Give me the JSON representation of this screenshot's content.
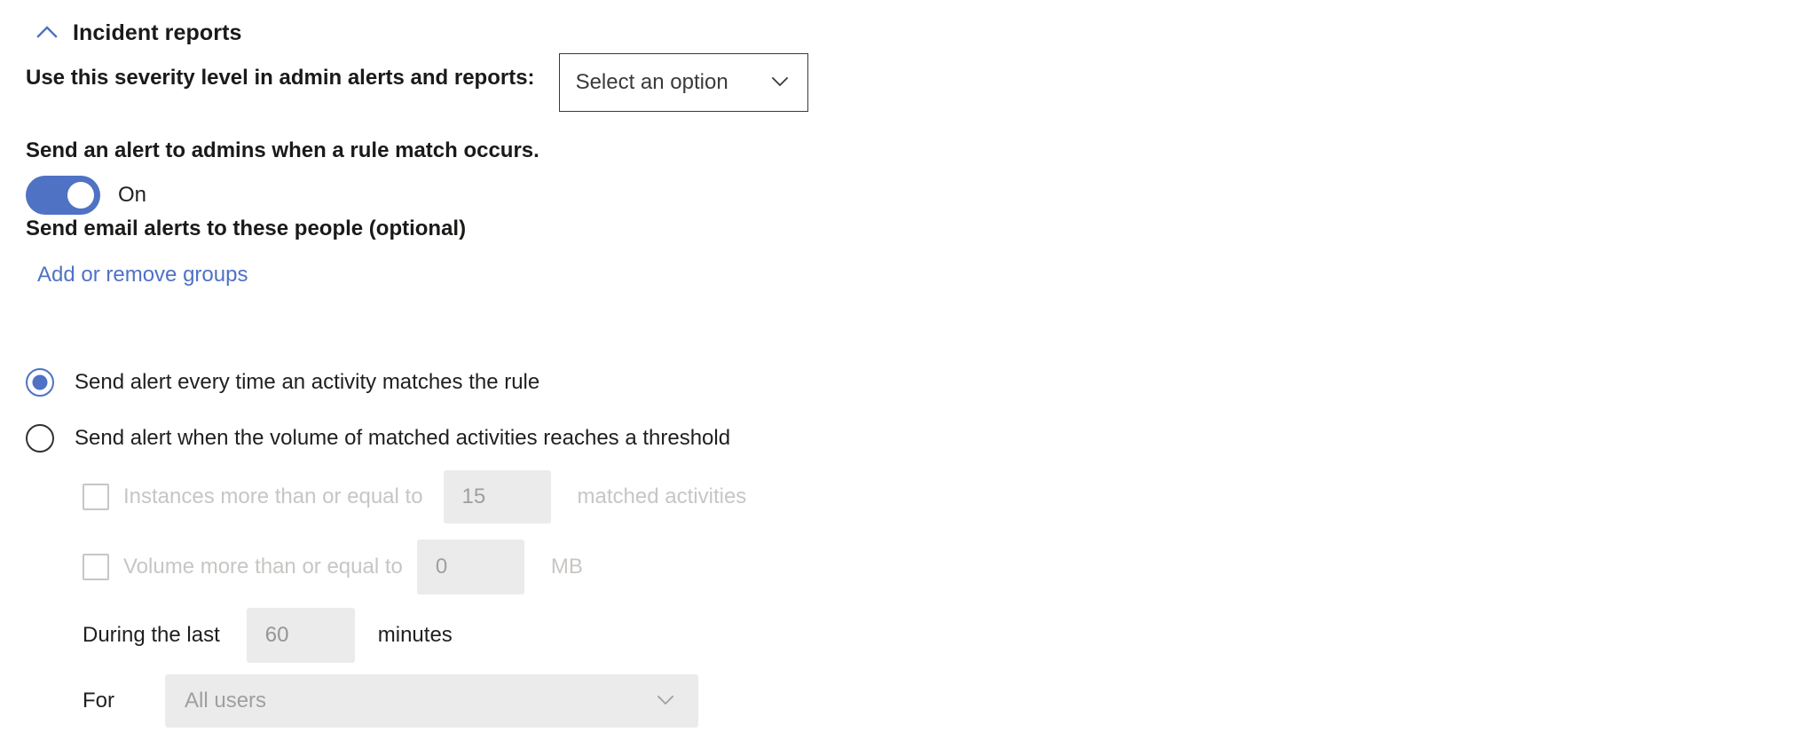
{
  "section": {
    "title": "Incident reports",
    "collapse_icon": "chevron-up-icon",
    "accent_color": "#4f72c4"
  },
  "severity": {
    "label": "Use this severity level in admin alerts and reports:",
    "dropdown_value": "Select an option",
    "dropdown_icon": "chevron-down-icon"
  },
  "admin_alert": {
    "description": "Send an alert to admins when a rule match occurs.",
    "toggle_state": "On",
    "toggle_on": true
  },
  "email_alerts": {
    "label": "Send email alerts to these people (optional)",
    "link": "Add or remove groups"
  },
  "alert_mode": {
    "options": [
      {
        "label": "Send alert every time an activity matches the rule",
        "selected": true
      },
      {
        "label": "Send alert when the volume of matched activities reaches a threshold",
        "selected": false
      }
    ]
  },
  "threshold": {
    "instances": {
      "checkbox_label": "Instances more than or equal to",
      "value": "15",
      "unit": "matched activities",
      "checked": false,
      "disabled": true
    },
    "volume": {
      "checkbox_label": "Volume more than or equal to",
      "value": "0",
      "unit": "MB",
      "checked": false,
      "disabled": true
    },
    "during": {
      "label": "During the last",
      "value": "60",
      "unit": "minutes"
    },
    "for": {
      "label": "For",
      "value": "All users",
      "dropdown_icon": "chevron-down-icon"
    }
  }
}
